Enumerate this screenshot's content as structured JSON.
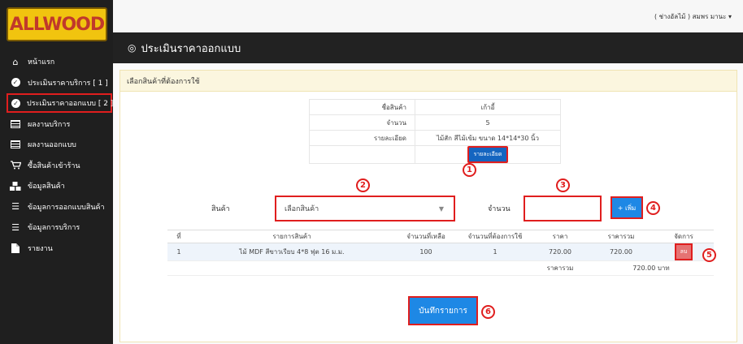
{
  "logo": "ALLWOOD",
  "sidebar": {
    "items": [
      {
        "icon": "home-icon",
        "label": "หน้าแรก"
      },
      {
        "icon": "check-circle-icon",
        "label": "ประเมินราคาบริการ [ 1 ]"
      },
      {
        "icon": "check-circle-icon",
        "label": "ประเมินราคาออกแบบ [ 2 ]"
      },
      {
        "icon": "table-icon",
        "label": "ผลงานบริการ"
      },
      {
        "icon": "table-icon",
        "label": "ผลงานออกแบบ"
      },
      {
        "icon": "cart-icon",
        "label": "ซื้อสินค้าเข้าร้าน"
      },
      {
        "icon": "cubes-icon",
        "label": "ข้อมูลสินค้า"
      },
      {
        "icon": "list-icon",
        "label": "ข้อมูลการออกแบบสินค้า"
      },
      {
        "icon": "list-icon",
        "label": "ข้อมูลการบริการ"
      },
      {
        "icon": "file-icon",
        "label": "รายงาน"
      }
    ]
  },
  "topbar": {
    "user": "( ช่างอัลไม้ ) สมพร มานะ ▾"
  },
  "page": {
    "title": "ประเมินราคาออกแบบ"
  },
  "panel": {
    "title": "เลือกสินค้าที่ต้องการใช้"
  },
  "info": {
    "rows": [
      {
        "label": "ชื่อสินค้า",
        "value": "เก้าอี้"
      },
      {
        "label": "จำนวน",
        "value": "5"
      },
      {
        "label": "รายละเอียด",
        "value": "ไม้สัก สีไม้เข้ม ขนาด 14*14*30 นิ้ว"
      }
    ],
    "detail_button": "รายละเอียด"
  },
  "form": {
    "product_label": "สินค้า",
    "product_select": "เลือกสินค้า",
    "qty_label": "จำนวน",
    "qty_value": "",
    "add_button": "+ เพิ่ม"
  },
  "items": {
    "headers": [
      "ที่",
      "รายการสินค้า",
      "จำนวนที่เหลือ",
      "จำนวนที่ต้องการใช้",
      "ราคา",
      "ราคารวม",
      "จัดการ"
    ],
    "rows": [
      {
        "no": "1",
        "name": "ไม้ MDF สีขาวเรียบ 4*8 ฟุต 16 ม.ม.",
        "remaining": "100",
        "qty": "1",
        "price": "720.00",
        "total": "720.00",
        "action": "ลบ"
      }
    ],
    "sum_label": "ราคารวม",
    "sum_value": "720.00 บาท"
  },
  "save_button": "บันทึกรายการ",
  "callouts": [
    "1",
    "2",
    "3",
    "4",
    "5",
    "6"
  ],
  "colors": {
    "highlight": "#e01e1e",
    "primary": "#1e88e5",
    "sidebar": "#1f1f1f",
    "logo_bg": "#f1c40f"
  }
}
